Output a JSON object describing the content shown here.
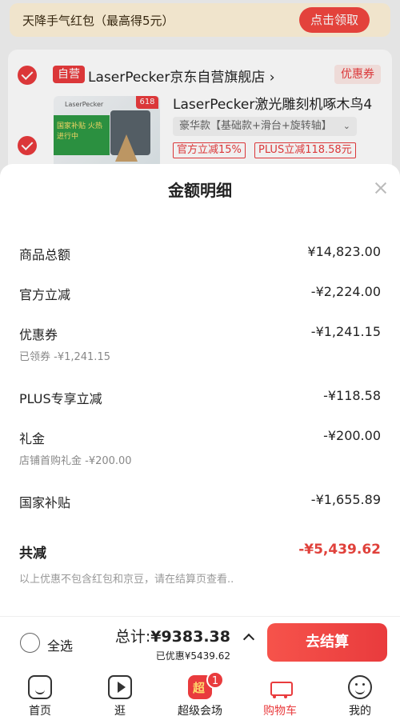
{
  "promo": {
    "text": "天降手气红包（最高得5元）",
    "button": "点击领取"
  },
  "store": {
    "self_tag": "自营",
    "name": "LaserPecker京东自营旗舰店 ›",
    "coupon": "优惠券"
  },
  "product": {
    "image_brand": "LaserPecker",
    "image_badge": "618",
    "image_promo": "国家补贴 火热进行中",
    "title": "LaserPecker激光雕刻机啄木鸟4",
    "spec": "豪华款【基础款+滑台+旋转轴】",
    "chips": [
      "官方立减15%",
      "PLUS立减118.58元"
    ]
  },
  "sheet": {
    "title": "金额明细",
    "rows": [
      {
        "label": "商品总额",
        "value": "¥14,823.00",
        "sub": ""
      },
      {
        "label": "官方立减",
        "value": "-¥2,224.00",
        "sub": ""
      },
      {
        "label": "优惠券",
        "value": "-¥1,241.15",
        "sub": "已领券 -¥1,241.15"
      },
      {
        "label": "PLUS专享立减",
        "value": "-¥118.58",
        "sub": ""
      },
      {
        "label": "礼金",
        "value": "-¥200.00",
        "sub": "店铺首购礼金 -¥200.00"
      },
      {
        "label": "国家补贴",
        "value": "-¥1,655.89",
        "sub": ""
      }
    ],
    "total_label": "共减",
    "total_value": "-¥5,439.62",
    "note": "以上优惠不包含红包和京豆，请在结算页查看.."
  },
  "checkout": {
    "select_all": "全选",
    "total_prefix": "总计:",
    "total_amount": "¥9383.38",
    "saved": "已优惠¥5439.62",
    "button": "去结算"
  },
  "tabs": [
    {
      "label": "首页",
      "icon": "home-icon"
    },
    {
      "label": "逛",
      "icon": "video-icon"
    },
    {
      "label": "超级会场",
      "icon": "super-venue-icon",
      "badge": "1"
    },
    {
      "label": "购物车",
      "icon": "cart-icon",
      "active": true
    },
    {
      "label": "我的",
      "icon": "profile-icon"
    }
  ],
  "colors": {
    "accent": "#e93b3d",
    "discount_total": "#e0413b"
  }
}
